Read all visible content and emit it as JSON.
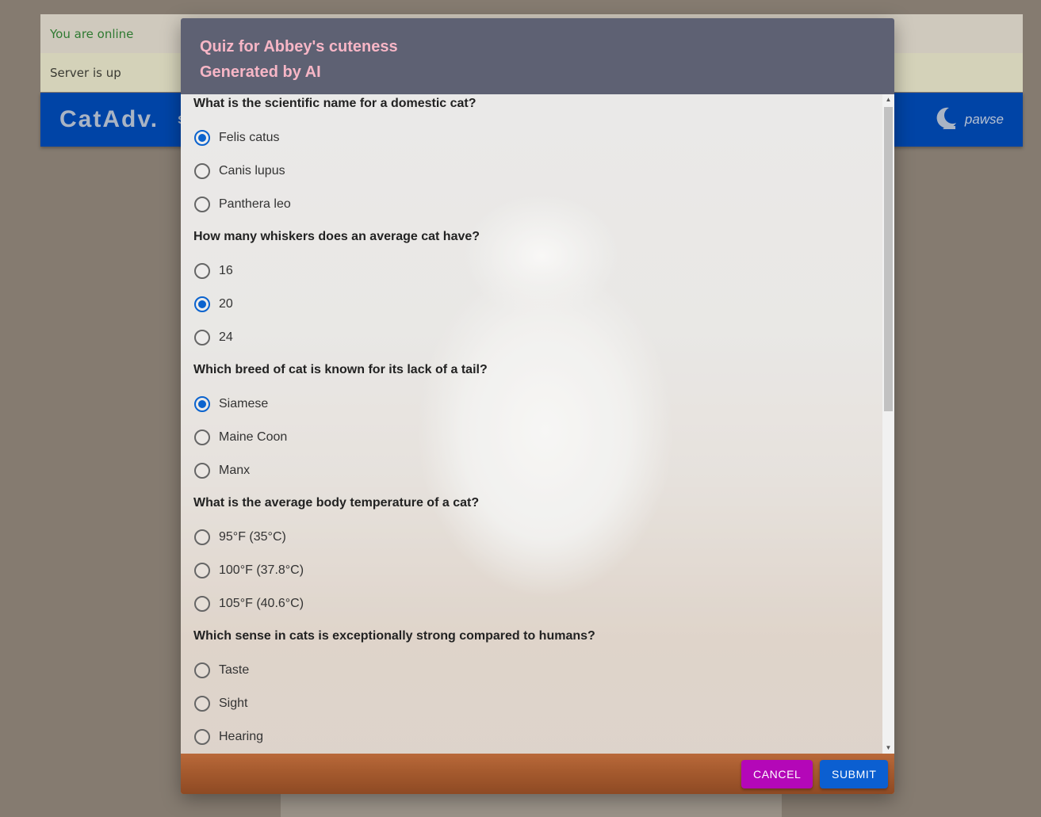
{
  "status": {
    "online_text": "You are online",
    "server_text": "Server is up"
  },
  "navbar": {
    "brand": "CatAdv.",
    "nav_link_partial": "S",
    "user_name": "pawse"
  },
  "dialog": {
    "title": "Quiz for Abbey's cuteness",
    "subtitle": "Generated by AI",
    "questions": [
      {
        "text": "What is the scientific name for a domestic cat?",
        "options": [
          {
            "label": "Felis catus",
            "checked": true
          },
          {
            "label": "Canis lupus",
            "checked": false
          },
          {
            "label": "Panthera leo",
            "checked": false
          }
        ]
      },
      {
        "text": "How many whiskers does an average cat have?",
        "options": [
          {
            "label": "16",
            "checked": false
          },
          {
            "label": "20",
            "checked": true
          },
          {
            "label": "24",
            "checked": false
          }
        ]
      },
      {
        "text": "Which breed of cat is known for its lack of a tail?",
        "options": [
          {
            "label": "Siamese",
            "checked": true
          },
          {
            "label": "Maine Coon",
            "checked": false
          },
          {
            "label": "Manx",
            "checked": false
          }
        ]
      },
      {
        "text": "What is the average body temperature of a cat?",
        "options": [
          {
            "label": "95°F (35°C)",
            "checked": false
          },
          {
            "label": "100°F (37.8°C)",
            "checked": false
          },
          {
            "label": "105°F (40.6°C)",
            "checked": false
          }
        ]
      },
      {
        "text": "Which sense in cats is exceptionally strong compared to humans?",
        "options": [
          {
            "label": "Taste",
            "checked": false
          },
          {
            "label": "Sight",
            "checked": false
          },
          {
            "label": "Hearing",
            "checked": false
          }
        ]
      }
    ],
    "actions": {
      "cancel_label": "CANCEL",
      "submit_label": "SUBMIT"
    }
  },
  "colors": {
    "navbar": "#0044a6",
    "dialog_header": "#5e6173",
    "title_pink": "#f7b6c6",
    "radio_selected": "#0b63ce",
    "cancel_button": "#b407b8",
    "submit_button": "#0b5fd1"
  },
  "icons": {
    "user_avatar": "moon-cat-icon"
  }
}
